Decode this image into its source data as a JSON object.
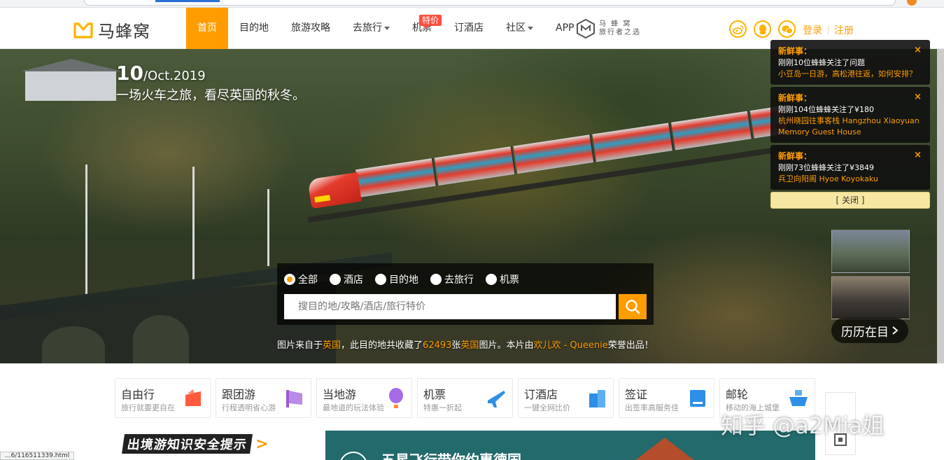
{
  "header": {
    "logo_text": "马蜂窝",
    "nav": [
      {
        "label": "首页",
        "active": true
      },
      {
        "label": "目的地"
      },
      {
        "label": "旅游攻略"
      },
      {
        "label": "去旅行",
        "dropdown": true
      },
      {
        "label": "机票",
        "badge": "特价"
      },
      {
        "label": "订酒店"
      },
      {
        "label": "社区",
        "dropdown": true
      },
      {
        "label": "APP"
      }
    ],
    "slogan_line1": "马 蜂 窝",
    "slogan_line2": "旅行者之选",
    "social_icons": [
      "weibo-icon",
      "qq-icon",
      "wechat-icon"
    ],
    "login": "登录",
    "register": "注册"
  },
  "hero": {
    "date_day": "10",
    "date_rest": "/Oct.2019",
    "caption": "一场火车之旅，看尽英国的秋冬。",
    "search": {
      "options": [
        {
          "label": "全部",
          "checked": true
        },
        {
          "label": "酒店",
          "checked": false
        },
        {
          "label": "目的地",
          "checked": false
        },
        {
          "label": "去旅行",
          "checked": false
        },
        {
          "label": "机票",
          "checked": false
        }
      ],
      "placeholder": "搜目的地/攻略/酒店/旅行特价"
    },
    "credit": {
      "p1": "图片来自于",
      "place1": "英国",
      "p2": "，此目的地共收藏了",
      "count": "62493",
      "p3": "张",
      "place2": "英国",
      "p4": "图片。本片由",
      "author": "欢儿欢 - Queenie",
      "p5": "荣誉出品！"
    },
    "history_label": "历历在目"
  },
  "notices": [
    {
      "title": "新鲜事：",
      "body": "刚刚10位蜂蜂关注了问题",
      "link": "小豆岛一日游，高松港往返，如何安排？"
    },
    {
      "title": "新鲜事：",
      "body": "刚刚104位蜂蜂关注了¥180",
      "link": "杭州晓园往事客栈 Hangzhou Xiaoyuan Memory Guest House"
    },
    {
      "title": "新鲜事：",
      "body": "刚刚73位蜂蜂关注了¥3849",
      "link": "兵卫向阳阁 Hyoe Koyokaku"
    }
  ],
  "notice_close_all": "[ 关闭 ]",
  "services": [
    {
      "title": "自由行",
      "sub": "旅行就要更自在",
      "icon": "flag-icon",
      "color": "#ff5a3c"
    },
    {
      "title": "跟团游",
      "sub": "行程透明省心游",
      "icon": "group-flag-icon",
      "color": "#9b59d0"
    },
    {
      "title": "当地游",
      "sub": "最地道的玩法体验",
      "icon": "balloon-icon",
      "color": "#a66be8"
    },
    {
      "title": "机票",
      "sub": "特惠一折起",
      "icon": "plane-icon",
      "color": "#2e8fe6"
    },
    {
      "title": "订酒店",
      "sub": "一键全网比价",
      "icon": "hotel-icon",
      "color": "#2e8fe6"
    },
    {
      "title": "签证",
      "sub": "出签率高服务佳",
      "icon": "passport-icon",
      "color": "#2e8fe6"
    },
    {
      "title": "邮轮",
      "sub": "移动的海上城堡",
      "icon": "cruise-icon",
      "color": "#2e8fe6"
    }
  ],
  "safety_banner": "出境游知识安全提示",
  "promo_text": "五星飞行带你约惠德国",
  "watermark": "知乎 @a2Mia姐",
  "status_url": "...6/116511339.html",
  "colors": {
    "accent": "#ff9d00",
    "notice_bg": "#0f0f0f",
    "close_bar": "#f6e7a3"
  }
}
